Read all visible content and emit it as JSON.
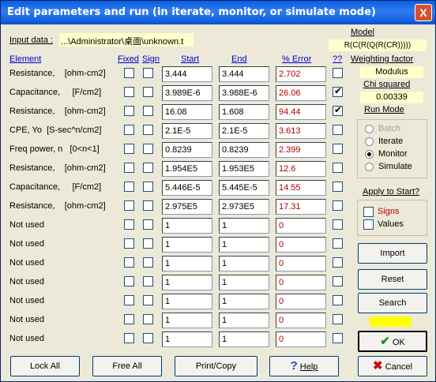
{
  "window": {
    "title": "Edit parameters and run (in iterate, monitor, or simulate mode)",
    "close_glyph": "X"
  },
  "input": {
    "label": "Input data :",
    "value": "...\\Administrator\\桌面\\unknown.t"
  },
  "model": {
    "label": "Model",
    "value": "R(C(R(Q(R(CR)))))"
  },
  "weighting": {
    "label": "Weighting  factor",
    "value": "Modulus"
  },
  "chi": {
    "label": "Chi squared",
    "value": "0.00339"
  },
  "runmode": {
    "label": "Run Mode",
    "options": [
      {
        "label": "Batch",
        "selected": false,
        "enabled": false
      },
      {
        "label": "Iterate",
        "selected": false,
        "enabled": true
      },
      {
        "label": "Monitor",
        "selected": true,
        "enabled": true
      },
      {
        "label": "Simulate",
        "selected": false,
        "enabled": true
      }
    ]
  },
  "apply": {
    "label": "Apply to Start?",
    "signs": "Signs",
    "values": "Values"
  },
  "headers": {
    "element": "Element",
    "fixed": "Fixed",
    "sign": "Sign",
    "start": "Start",
    "end": "End",
    "error": "% Error",
    "qq": "??"
  },
  "rows": [
    {
      "element": "Resistance,    [ohm-cm2]",
      "start": "3.444",
      "end": "3.444",
      "error": "2.702",
      "qq": false
    },
    {
      "element": "Capacitance,     [F/cm2]",
      "start": "3.989E-6",
      "end": "3.988E-6",
      "error": "26.06",
      "qq": true
    },
    {
      "element": "Resistance,    [ohm-cm2]",
      "start": "16.08",
      "end": "1.608",
      "error": "94.44",
      "qq": true
    },
    {
      "element": "CPE, Yo  [S-sec^n/cm2]",
      "start": "2.1E-5",
      "end": "2.1E-5",
      "error": "3.613",
      "qq": false
    },
    {
      "element": "Freq power, n   [0<n<1]",
      "start": "0.8239",
      "end": "0.8239",
      "error": "2.399",
      "qq": false
    },
    {
      "element": "Resistance,    [ohm-cm2]",
      "start": "1.954E5",
      "end": "1.953E5",
      "error": "12.6",
      "qq": false
    },
    {
      "element": "Capacitance,     [F/cm2]",
      "start": "5.446E-5",
      "end": "5.445E-5",
      "error": "14.55",
      "qq": false
    },
    {
      "element": "Resistance,    [ohm-cm2]",
      "start": "2.975E5",
      "end": "2.973E5",
      "error": "17.31",
      "qq": false
    },
    {
      "element": "Not used",
      "start": "1",
      "end": "1",
      "error": "0",
      "qq": false
    },
    {
      "element": "Not used",
      "start": "1",
      "end": "1",
      "error": "0",
      "qq": false
    },
    {
      "element": "Not used",
      "start": "1",
      "end": "1",
      "error": "0",
      "qq": false
    },
    {
      "element": "Not used",
      "start": "1",
      "end": "1",
      "error": "0",
      "qq": false
    },
    {
      "element": "Not used",
      "start": "1",
      "end": "1",
      "error": "0",
      "qq": false
    },
    {
      "element": "Not used",
      "start": "1",
      "end": "1",
      "error": "0",
      "qq": false
    },
    {
      "element": "Not used",
      "start": "1",
      "end": "1",
      "error": "0",
      "qq": false
    }
  ],
  "buttons": {
    "import": "Import",
    "reset": "Reset",
    "search": "Search",
    "ok": "OK",
    "lock_all": "Lock All",
    "free_all": "Free All",
    "print_copy": "Print/Copy",
    "help": "Help",
    "cancel": "Cancel"
  },
  "colors": {
    "title_blue": "#0a5fe0",
    "error_text": "#b00000",
    "link_blue": "#0000cc",
    "yellow_indicator": "#ffff00"
  }
}
